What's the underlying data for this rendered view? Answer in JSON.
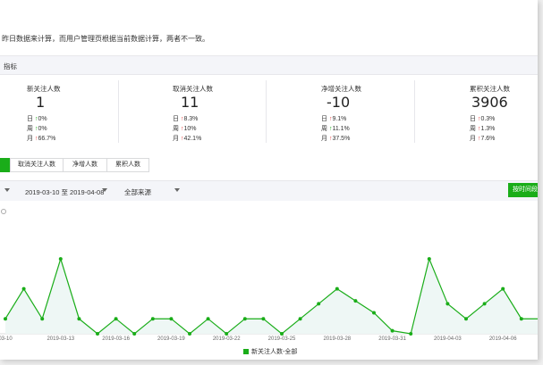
{
  "notice": "昨日数据来计算，而用户管理页根据当前数据计算，两者不一致。",
  "section_title": "指标",
  "metrics": [
    {
      "label": "新关注人数",
      "value": "1",
      "rows": [
        {
          "period": "日",
          "dir": "up-green",
          "pct": "0%"
        },
        {
          "period": "周",
          "dir": "up-green",
          "pct": "0%"
        },
        {
          "period": "月",
          "dir": "up-red",
          "pct": "66.7%"
        }
      ]
    },
    {
      "label": "取消关注人数",
      "value": "11",
      "rows": [
        {
          "period": "日",
          "dir": "up-red",
          "pct": "8.3%"
        },
        {
          "period": "周",
          "dir": "up-red",
          "pct": "10%"
        },
        {
          "period": "月",
          "dir": "up-red",
          "pct": "42.1%"
        }
      ]
    },
    {
      "label": "净增关注人数",
      "value": "-10",
      "rows": [
        {
          "period": "日",
          "dir": "up-red",
          "pct": "9.1%"
        },
        {
          "period": "周",
          "dir": "up-green",
          "pct": "11.1%"
        },
        {
          "period": "月",
          "dir": "up-red",
          "pct": "37.5%"
        }
      ]
    },
    {
      "label": "累积关注人数",
      "value": "3906",
      "rows": [
        {
          "period": "日",
          "dir": "up-red",
          "pct": "0.3%"
        },
        {
          "period": "周",
          "dir": "up-red",
          "pct": "1.3%"
        },
        {
          "period": "月",
          "dir": "up-red",
          "pct": "7.6%"
        }
      ]
    }
  ],
  "tabs": [
    "取消关注人数",
    "净增人数",
    "累积人数"
  ],
  "filters": {
    "date_range": "2019-03-10 至 2019-04-08",
    "source": "全部来源",
    "export_label": "按时间段"
  },
  "colors": {
    "accent": "#1aad19",
    "red": "#e64340",
    "chart_fill": "#eef7f5"
  },
  "chart_data": {
    "type": "line",
    "x": [
      "2019-03-10",
      "2019-03-11",
      "2019-03-12",
      "2019-03-13",
      "2019-03-14",
      "2019-03-15",
      "2019-03-16",
      "2019-03-17",
      "2019-03-18",
      "2019-03-19",
      "2019-03-20",
      "2019-03-21",
      "2019-03-22",
      "2019-03-23",
      "2019-03-24",
      "2019-03-25",
      "2019-03-26",
      "2019-03-27",
      "2019-03-28",
      "2019-03-29",
      "2019-03-30",
      "2019-03-31",
      "2019-04-01",
      "2019-04-02",
      "2019-04-03",
      "2019-04-04",
      "2019-04-05",
      "2019-04-06",
      "2019-04-07",
      "2019-04-08"
    ],
    "tick_labels": [
      "03-10",
      "2019-03-13",
      "2019-03-16",
      "2019-03-19",
      "2019-03-22",
      "2019-03-25",
      "2019-03-28",
      "2019-03-31",
      "2019-04-03",
      "2019-04-06"
    ],
    "tick_index": [
      0,
      3,
      6,
      9,
      12,
      15,
      18,
      21,
      24,
      27
    ],
    "series": [
      {
        "name": "新关注人数-全部",
        "values": [
          1,
          2,
          1,
          3,
          1,
          0.5,
          1,
          0.5,
          1,
          1,
          0.5,
          1,
          0.5,
          1,
          1,
          0.5,
          1,
          1.5,
          2,
          1.6,
          1.2,
          0.6,
          0.5,
          3,
          1.5,
          1,
          1.5,
          2,
          1,
          1
        ]
      }
    ],
    "ylim": [
      0.5,
      3.3
    ]
  }
}
